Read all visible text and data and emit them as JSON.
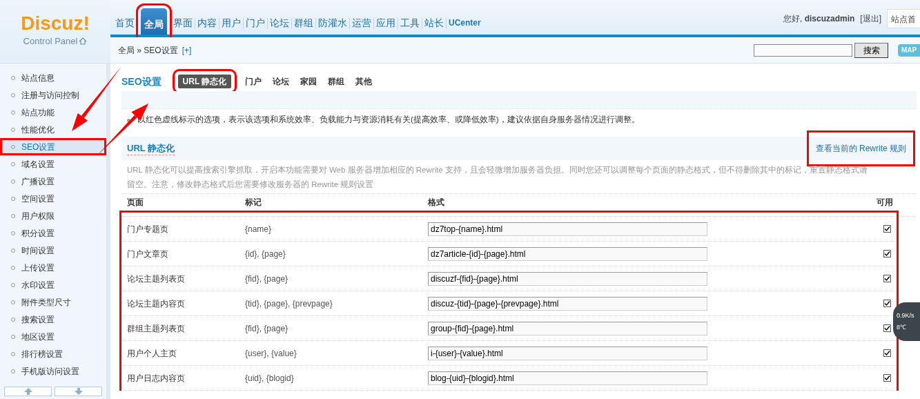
{
  "header": {
    "logo": {
      "title": "Discuz!",
      "subtitle": "Control Panel"
    },
    "nav": [
      {
        "label": "首页",
        "selected": false
      },
      {
        "label": "全局",
        "selected": true
      },
      {
        "label": "界面",
        "selected": false
      },
      {
        "label": "内容",
        "selected": false
      },
      {
        "label": "用户",
        "selected": false
      },
      {
        "label": "门户",
        "selected": false
      },
      {
        "label": "论坛",
        "selected": false
      },
      {
        "label": "群组",
        "selected": false
      },
      {
        "label": "防灌水",
        "selected": false
      },
      {
        "label": "运营",
        "selected": false
      },
      {
        "label": "应用",
        "selected": false
      },
      {
        "label": "工具",
        "selected": false
      },
      {
        "label": "站长",
        "selected": false
      },
      {
        "label": "UCenter",
        "selected": false
      }
    ],
    "user": {
      "greeting": "您好,",
      "name": "discuzadmin",
      "logout": "[退出]"
    },
    "site_link": "站点首"
  },
  "breadcrumb": {
    "path": "全局 » SEO设置",
    "add": "[+]"
  },
  "search": {
    "button": "搜索"
  },
  "map": "MAP",
  "sidebar": {
    "items": [
      {
        "label": "站点信息",
        "selected": false
      },
      {
        "label": "注册与访问控制",
        "selected": false
      },
      {
        "label": "站点功能",
        "selected": false
      },
      {
        "label": "性能优化",
        "selected": false
      },
      {
        "label": "SEO设置",
        "selected": true
      },
      {
        "label": "域名设置",
        "selected": false
      },
      {
        "label": "广播设置",
        "selected": false
      },
      {
        "label": "空间设置",
        "selected": false
      },
      {
        "label": "用户权限",
        "selected": false
      },
      {
        "label": "积分设置",
        "selected": false
      },
      {
        "label": "时间设置",
        "selected": false
      },
      {
        "label": "上传设置",
        "selected": false
      },
      {
        "label": "水印设置",
        "selected": false
      },
      {
        "label": "附件类型尺寸",
        "selected": false
      },
      {
        "label": "搜索设置",
        "selected": false
      },
      {
        "label": "地区设置",
        "selected": false
      },
      {
        "label": "排行榜设置",
        "selected": false
      },
      {
        "label": "手机版访问设置",
        "selected": false
      }
    ]
  },
  "content": {
    "title": "SEO设置",
    "tabs": [
      {
        "label": "URL 静态化",
        "selected": true
      },
      {
        "label": "门户",
        "selected": false
      },
      {
        "label": "论坛",
        "selected": false
      },
      {
        "label": "家园",
        "selected": false
      },
      {
        "label": "群组",
        "selected": false
      },
      {
        "label": "其他",
        "selected": false
      }
    ],
    "tip": "以红色虚线标示的选项，表示该选项和系统效率、负载能力与资源消耗有关(提高效率、或降低效率)，建议依据自身服务器情况进行调整。",
    "section": {
      "title": "URL 静态化",
      "link": "查看当前的 Rewrite 规则",
      "description": "URL 静态化可以提高搜索引擎抓取，开启本功能需要对 Web 服务器增加相应的 Rewrite 支持，且会轻微增加服务器负担。同时您还可以调整每个页面的静态格式，但不得删除其中的标记，重置静态格式请留空。注意，修改静态格式后您需要修改服务器的 Rewrite 规则设置"
    },
    "table": {
      "columns": [
        "页面",
        "标记",
        "格式",
        "可用"
      ],
      "rows": [
        {
          "page": "门户专题页",
          "marks": "{name}",
          "format": "dz7top-{name}.html",
          "enabled": true
        },
        {
          "page": "门户文章页",
          "marks": "{id}, {page}",
          "format": "dz7article-{id}-{page}.html",
          "enabled": true
        },
        {
          "page": "论坛主题列表页",
          "marks": "{fid}, {page}",
          "format": "discuzf-{fid}-{page}.html",
          "enabled": true
        },
        {
          "page": "论坛主题内容页",
          "marks": "{tid}, {page}, {prevpage}",
          "format": "discuz-{tid}-{page}-{prevpage}.html",
          "enabled": true
        },
        {
          "page": "群组主题列表页",
          "marks": "{fid}, {page}",
          "format": "group-{fid}-{page}.html",
          "enabled": true
        },
        {
          "page": "用户个人主页",
          "marks": "{user}, {value}",
          "format": "i-{user}-{value}.html",
          "enabled": true
        },
        {
          "page": "用户日志内容页",
          "marks": "{uid}, {blogid}",
          "format": "blog-{uid}-{blogid}.html",
          "enabled": true
        }
      ]
    }
  },
  "widget": {
    "speed": "0.9K/s",
    "temperature": "8℃"
  }
}
